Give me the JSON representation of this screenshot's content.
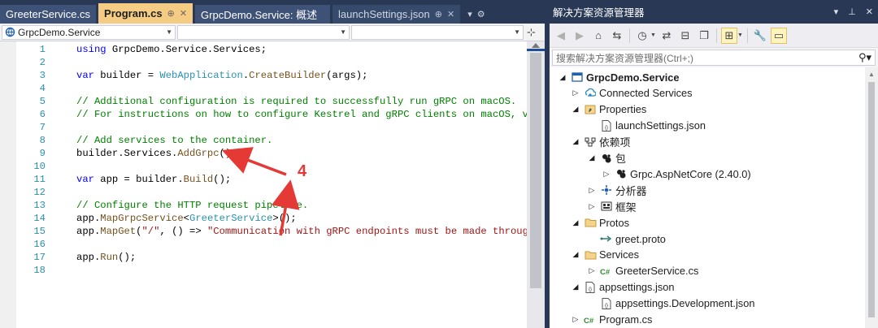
{
  "tabs": [
    {
      "label": "GreeterService.cs"
    },
    {
      "label": "Program.cs",
      "pin": "⊕",
      "close": "✕"
    },
    {
      "label": "GrpcDemo.Service: 概述"
    },
    {
      "label": "launchSettings.json",
      "pin": "⊕",
      "close": "✕"
    }
  ],
  "tabstrip": {
    "overflow": "▾",
    "settings": "⚙"
  },
  "navbar": {
    "project": "GrpcDemo.Service",
    "type": "",
    "member": ""
  },
  "code_lines": [
    {
      "n": "1",
      "parts": [
        [
          "kw",
          "using"
        ],
        [
          "",
          "GrpcDemo.Service.Services;"
        ]
      ]
    },
    {
      "n": "2",
      "parts": []
    },
    {
      "n": "3",
      "parts": [
        [
          "kw",
          "var"
        ],
        [
          "",
          " builder = "
        ],
        [
          "ty",
          "WebApplication"
        ],
        [
          "",
          "."
        ],
        [
          "mt",
          "CreateBuilder"
        ],
        [
          "",
          "(args);"
        ]
      ]
    },
    {
      "n": "4",
      "parts": []
    },
    {
      "n": "5",
      "parts": [
        [
          "cm",
          "// Additional configuration is required to successfully run gRPC on macOS."
        ]
      ]
    },
    {
      "n": "6",
      "parts": [
        [
          "cm",
          "// For instructions on how to configure Kestrel and gRPC clients on macOS, visit"
        ]
      ]
    },
    {
      "n": "7",
      "parts": []
    },
    {
      "n": "8",
      "parts": [
        [
          "cm",
          "// Add services to the container."
        ]
      ]
    },
    {
      "n": "9",
      "parts": [
        [
          "",
          "builder.Services."
        ],
        [
          "mt",
          "AddGrpc"
        ],
        [
          "",
          "();"
        ]
      ]
    },
    {
      "n": "10",
      "parts": []
    },
    {
      "n": "11",
      "parts": [
        [
          "kw",
          "var"
        ],
        [
          "",
          " app = builder."
        ],
        [
          "mt",
          "Build"
        ],
        [
          "",
          "();"
        ]
      ]
    },
    {
      "n": "12",
      "parts": []
    },
    {
      "n": "13",
      "parts": [
        [
          "cm",
          "// Configure the HTTP request pipeline."
        ]
      ]
    },
    {
      "n": "14",
      "parts": [
        [
          "",
          "app."
        ],
        [
          "mt",
          "MapGrpcService"
        ],
        [
          "",
          "<"
        ],
        [
          "ty",
          "GreeterService"
        ],
        [
          "",
          ">();"
        ]
      ]
    },
    {
      "n": "15",
      "parts": [
        [
          "",
          "app."
        ],
        [
          "mt",
          "MapGet"
        ],
        [
          "",
          "("
        ],
        [
          "st",
          "\"/\""
        ],
        [
          "",
          ", () => "
        ],
        [
          "st",
          "\"Communication with gRPC endpoints must be made through a"
        ]
      ]
    },
    {
      "n": "16",
      "parts": []
    },
    {
      "n": "17",
      "parts": [
        [
          "",
          "app."
        ],
        [
          "mt",
          "Run"
        ],
        [
          "",
          "();"
        ]
      ]
    },
    {
      "n": "18",
      "parts": []
    }
  ],
  "annotation": {
    "number": "4",
    "color": "#e53935"
  },
  "solution_explorer": {
    "title": "解决方案资源管理器",
    "title_controls": [
      "▾",
      "⊥",
      "✕"
    ],
    "search_placeholder": "搜索解决方案资源管理器(Ctrl+;)",
    "tree": [
      {
        "label": "GrpcDemo.Service",
        "expander": "◢",
        "icon": "project-icon"
      },
      {
        "label": "Connected Services",
        "expander": "▷",
        "icon": "connected-services-icon"
      },
      {
        "label": "Properties",
        "expander": "◢",
        "icon": "properties-icon"
      },
      {
        "label": "launchSettings.json",
        "expander": "",
        "icon": "json-file-icon"
      },
      {
        "label": "依赖项",
        "expander": "◢",
        "icon": "dependencies-icon"
      },
      {
        "label": "包",
        "expander": "◢",
        "icon": "package-icon"
      },
      {
        "label": "Grpc.AspNetCore (2.40.0)",
        "expander": "▷",
        "icon": "package-icon"
      },
      {
        "label": "分析器",
        "expander": "▷",
        "icon": "analyzer-icon"
      },
      {
        "label": "框架",
        "expander": "▷",
        "icon": "framework-icon"
      },
      {
        "label": "Protos",
        "expander": "◢",
        "icon": "folder-icon"
      },
      {
        "label": "greet.proto",
        "expander": "",
        "icon": "proto-file-icon"
      },
      {
        "label": "Services",
        "expander": "◢",
        "icon": "folder-icon"
      },
      {
        "label": "GreeterService.cs",
        "expander": "▷",
        "icon": "csharp-file-icon"
      },
      {
        "label": "appsettings.json",
        "expander": "◢",
        "icon": "json-file-icon"
      },
      {
        "label": "appsettings.Development.json",
        "expander": "",
        "icon": "json-file-icon"
      },
      {
        "label": "Program.cs",
        "expander": "▷",
        "icon": "csharp-file-icon"
      }
    ]
  },
  "colors": {
    "titlebar": "#293955",
    "active_tab": "#f5cc84",
    "selection": "#cce8ff",
    "annotation": "#e53935"
  }
}
